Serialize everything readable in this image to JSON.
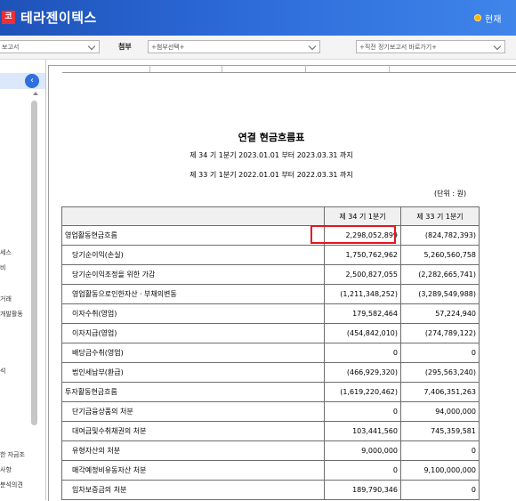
{
  "header": {
    "logo_glyph": "코",
    "app_title": "테라젠이텍스",
    "status_label": "현재"
  },
  "toolbar": {
    "report_select": "보고서",
    "attach_label": "첨부",
    "attach_select": "+첨부선택+",
    "prev_select": "+직전 정기보고서 바로가기+"
  },
  "sidebar": {
    "collapse_glyph": "‹",
    "items": [
      "세스",
      "비",
      "거래",
      "개발활동",
      "석",
      "한 자금조",
      "사항",
      "분석의견"
    ]
  },
  "document": {
    "title": "연결 현금흐름표",
    "period_current": "제 34 기 1분기 2023.01.01 부터 2023.03.31 까지",
    "period_prior": "제 33 기 1분기 2022.01.01 부터 2022.03.31 까지",
    "unit": "(단위 : 원)"
  },
  "table": {
    "headers": [
      "",
      "제 34 기 1분기",
      "제 33 기 1분기"
    ],
    "rows": [
      {
        "label": "영업활동현금흐름",
        "cur": "2,298,052,899",
        "prev": "(824,782,393)",
        "indent": false
      },
      {
        "label": "당기순이익(손실)",
        "cur": "1,750,762,962",
        "prev": "5,260,560,758",
        "indent": true
      },
      {
        "label": "당기순이익조정을 위한 가감",
        "cur": "2,500,827,055",
        "prev": "(2,282,665,741)",
        "indent": true
      },
      {
        "label": "영업활동으로인한자산ㆍ부채의변동",
        "cur": "(1,211,348,252)",
        "prev": "(3,289,549,988)",
        "indent": true
      },
      {
        "label": "이자수취(영업)",
        "cur": "179,582,464",
        "prev": "57,224,940",
        "indent": true
      },
      {
        "label": "이자지급(영업)",
        "cur": "(454,842,010)",
        "prev": "(274,789,122)",
        "indent": true
      },
      {
        "label": "배당금수취(영업)",
        "cur": "0",
        "prev": "0",
        "indent": true
      },
      {
        "label": "법인세납부(환급)",
        "cur": "(466,929,320)",
        "prev": "(295,563,240)",
        "indent": true
      },
      {
        "label": "투자활동현금흐름",
        "cur": "(1,619,220,462)",
        "prev": "7,406,351,263",
        "indent": false
      },
      {
        "label": "단기금융상품의 처분",
        "cur": "0",
        "prev": "94,000,000",
        "indent": true
      },
      {
        "label": "대여금및수취채권의 처분",
        "cur": "103,441,560",
        "prev": "745,359,581",
        "indent": true
      },
      {
        "label": "유형자산의 처분",
        "cur": "9,000,000",
        "prev": "0",
        "indent": true
      },
      {
        "label": "매각예정비유동자산 처분",
        "cur": "0",
        "prev": "9,100,000,000",
        "indent": true
      },
      {
        "label": "임차보증금의 처분",
        "cur": "189,790,346",
        "prev": "0",
        "indent": true
      }
    ]
  },
  "colors": {
    "header_start": "#1e52b8",
    "header_end": "#3f85ea",
    "highlight": "#e8131f",
    "logo": "#e8313a",
    "status_dot": "#ffb300"
  }
}
